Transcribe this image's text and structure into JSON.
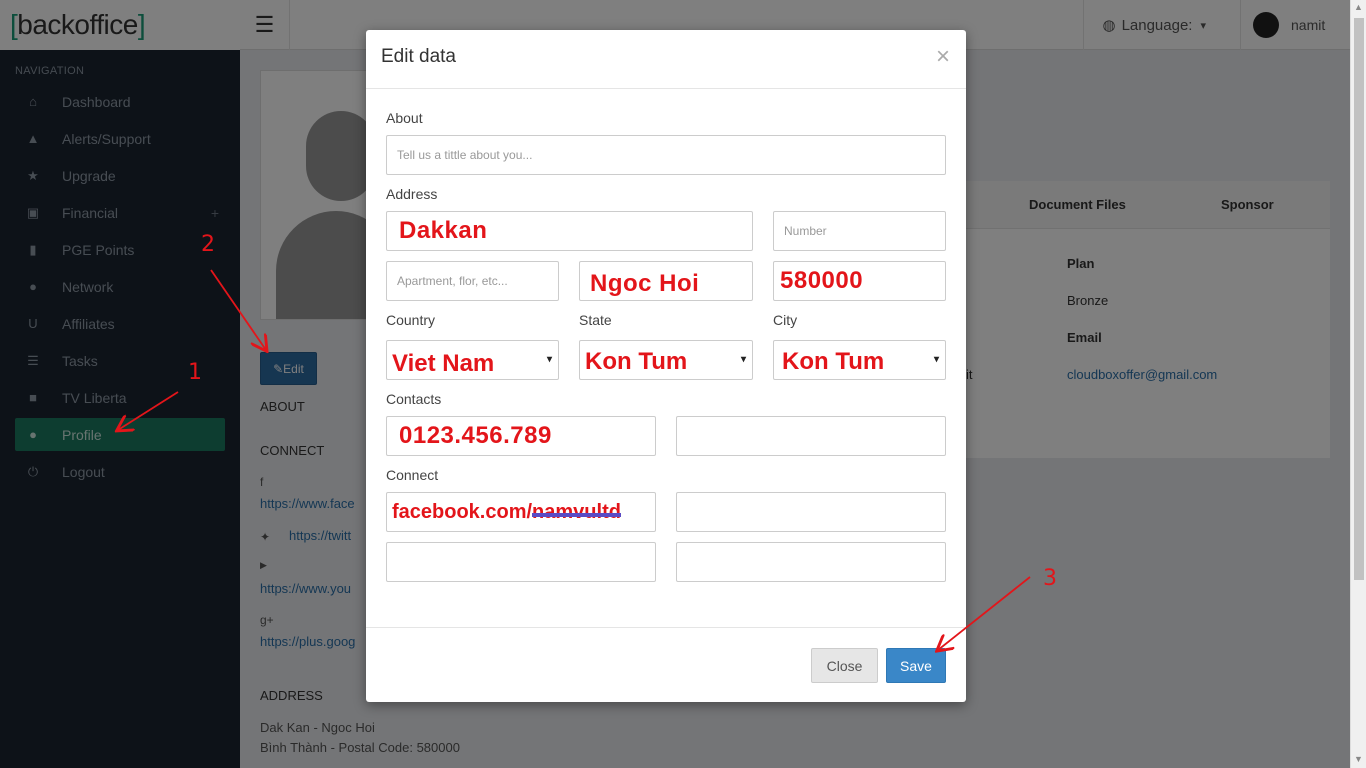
{
  "brand": {
    "open": "[",
    "name": "backoffice",
    "close": "]"
  },
  "sidebar": {
    "heading": "NAVIGATION",
    "items": [
      {
        "label": "Dashboard",
        "icon": "home-icon",
        "glyph": "⌂"
      },
      {
        "label": "Alerts/Support",
        "icon": "warning-icon",
        "glyph": "▲"
      },
      {
        "label": "Upgrade",
        "icon": "star-icon",
        "glyph": "★"
      },
      {
        "label": "Financial",
        "icon": "money-icon",
        "glyph": "▣",
        "extra": "+"
      },
      {
        "label": "PGE Points",
        "icon": "signal-icon",
        "glyph": "▮"
      },
      {
        "label": "Network",
        "icon": "users-icon",
        "glyph": "●"
      },
      {
        "label": "Affiliates",
        "icon": "magnet-icon",
        "glyph": "U"
      },
      {
        "label": "Tasks",
        "icon": "tasks-icon",
        "glyph": "☰"
      },
      {
        "label": "TV Liberta",
        "icon": "video-icon",
        "glyph": "■"
      },
      {
        "label": "Profile",
        "icon": "user-icon",
        "glyph": "●",
        "active": true
      },
      {
        "label": "Logout",
        "icon": "power-icon",
        "glyph": "⏻"
      }
    ]
  },
  "topbar": {
    "menu_glyph": "☰",
    "language_label": "Language:",
    "language_caret": "▾",
    "globe_glyph": "◍",
    "username": "namit"
  },
  "profile": {
    "edit_label": "✎Edit",
    "about_heading": "ABOUT",
    "connect_heading": "CONNECT",
    "links": [
      {
        "icon": "facebook-icon",
        "glyph": "f",
        "url": "https://www.face"
      },
      {
        "icon": "twitter-icon",
        "glyph": "✦",
        "url": "https://twitt"
      },
      {
        "icon": "youtube-icon",
        "glyph": "▶",
        "url": "https://www.you"
      },
      {
        "icon": "google-plus-icon",
        "glyph": "g+",
        "url": "https://plus.goog"
      }
    ],
    "address_heading": "ADDRESS",
    "address_line1": "Dak Kan - Ngoc Hoi",
    "address_line2": "Bình Thành - Postal Code: 580000"
  },
  "right_panel": {
    "col1": "Document Files",
    "col2": "Sponsor",
    "plan_label": "Plan",
    "plan_value": "Bronze",
    "email_label": "Email",
    "email_value": "cloudboxoffer@gmail.com",
    "trailing_fragment": "it"
  },
  "modal": {
    "title": "Edit data",
    "close_glyph": "×",
    "about_label": "About",
    "about_placeholder": "Tell us a tittle about you...",
    "address_label": "Address",
    "street_value": "Dakkan",
    "number_placeholder": "Number",
    "apartment_placeholder": "Apartment, flor, etc...",
    "district_value": "Ngoc Hoi",
    "postal_value": "580000",
    "country_label": "Country",
    "state_label": "State",
    "city_label": "City",
    "country_value": "Viet Nam",
    "state_value": "Kon Tum",
    "city_value": "Kon Tum",
    "caret_glyph": "▾",
    "contacts_label": "Contacts",
    "phone_value": "0123.456.789",
    "connect_label": "Connect",
    "facebook_prefix": "facebook.com/",
    "facebook_redacted": "namvultd",
    "close_label": "Close",
    "save_label": "Save"
  },
  "annotations": {
    "one": "1",
    "two": "2",
    "three": "3"
  },
  "colors": {
    "accent": "#1a7a60",
    "primary": "#3a87c8",
    "annotation": "#e3151a"
  }
}
